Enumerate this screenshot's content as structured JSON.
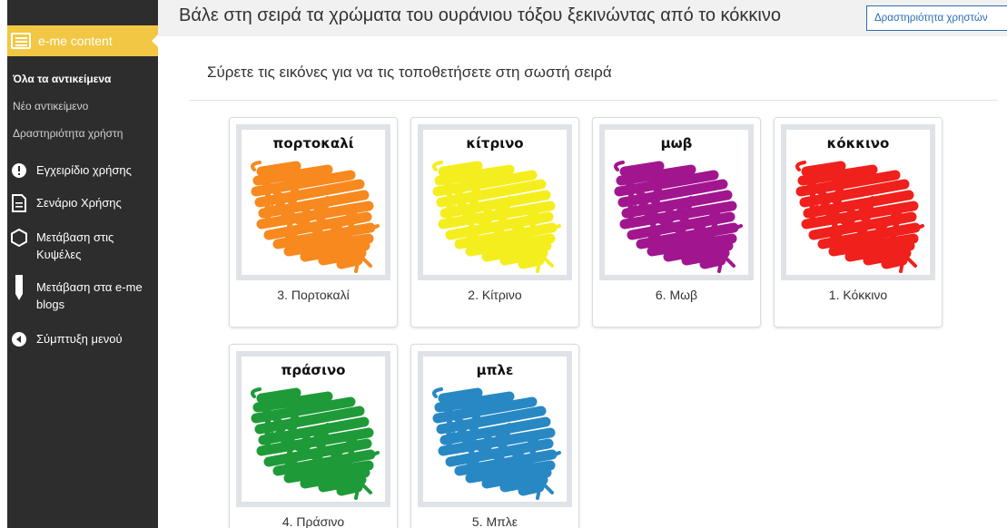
{
  "sidebar": {
    "header_label": "e-me content",
    "sub_items": [
      "Όλα τα αντικείμενα",
      "Νέο αντικείμενο",
      "Δραστηριότητα χρήστη"
    ],
    "items": [
      {
        "label": "Εγχειρίδιο χρήσης",
        "icon": "info-circle-icon"
      },
      {
        "label": "Σενάριο Χρήσης",
        "icon": "document-icon"
      },
      {
        "label": "Μετάβαση στις Κυψέλες",
        "icon": "hexagon-icon"
      },
      {
        "label": "Μετάβαση στα e-me blogs",
        "icon": "pencil-icon"
      },
      {
        "label": "Σύμπτυξη μενού",
        "icon": "collapse-arrow-icon"
      }
    ]
  },
  "header": {
    "title": "Βάλε στη σειρά τα χρώματα του ουράνιου τόξου ξεκινώντας από το κόκκινο",
    "activity_button": "Δραστηριότητα χρηστών"
  },
  "main": {
    "instructions": "Σύρετε τις εικόνες για να τις τοποθετήσετε στη σωστή σειρά",
    "cards": [
      {
        "word": "πορτοκαλί",
        "caption": "3. Πορτοκαλί",
        "color": "#f7891f"
      },
      {
        "word": "κίτρινο",
        "caption": "2. Κίτρινο",
        "color": "#f5ee1e"
      },
      {
        "word": "μωβ",
        "caption": "6. Μωβ",
        "color": "#a1168f"
      },
      {
        "word": "κόκκινο",
        "caption": "1. Κόκκινο",
        "color": "#f0201c"
      },
      {
        "word": "πράσινο",
        "caption": "4. Πράσινο",
        "color": "#1f9a38"
      },
      {
        "word": "μπλε",
        "caption": "5. Μπλε",
        "color": "#2888c4"
      }
    ]
  },
  "colors": {
    "sidebar_bg": "#2d2d2d",
    "sidebar_accent": "#f2c744",
    "link_blue": "#2b6cb0"
  }
}
